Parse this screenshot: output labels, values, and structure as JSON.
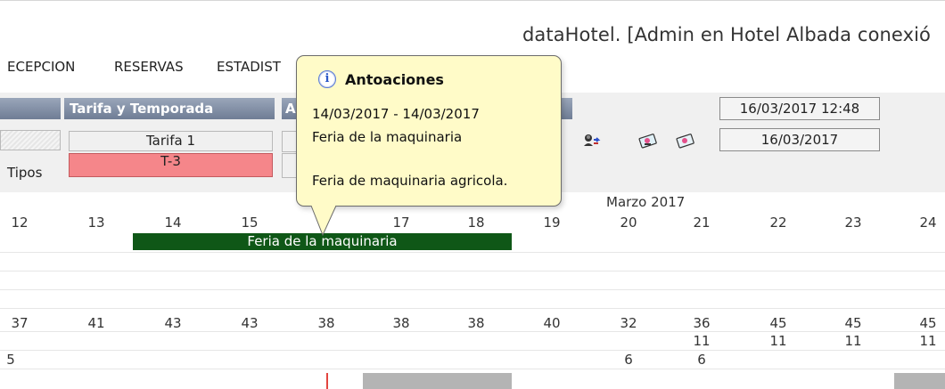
{
  "window": {
    "title": "dataHotel. [Admin en Hotel Albada conexió"
  },
  "menu": {
    "items": [
      {
        "label": "ECEPCION"
      },
      {
        "label": "RESERVAS"
      },
      {
        "label": "ESTADIST"
      }
    ]
  },
  "toolbar": {
    "tarifa_header": "Tarifa y Temporada",
    "second_header_fragment": "A",
    "tarifa_value": "Tarifa 1",
    "temporada_value": "T-3",
    "tipos_label": "Tipos",
    "datetime": "16/03/2017 12:48",
    "date": "16/03/2017",
    "colors": {
      "header_band": "#7b88a0",
      "temporada_bg": "#f5868a"
    }
  },
  "calendar": {
    "month": "Marzo 2017",
    "days": [
      "12",
      "13",
      "14",
      "15",
      "16",
      "17",
      "18",
      "19",
      "20",
      "21",
      "22",
      "23",
      "24"
    ],
    "event": {
      "label": "Feria de la maquinaria",
      "color": "#0f5717"
    },
    "row_totals": [
      "37",
      "41",
      "43",
      "43",
      "38",
      "38",
      "38",
      "40",
      "32",
      "36",
      "45",
      "45",
      "45"
    ],
    "row_second": [
      "",
      "",
      "",
      "",
      "",
      "",
      "",
      "",
      "",
      "11",
      "11",
      "11",
      "11"
    ],
    "row_third": [
      "5",
      "",
      "",
      "",
      "",
      "",
      "",
      "",
      "6",
      "6",
      "",
      "",
      ""
    ]
  },
  "tooltip": {
    "title": "Antoaciones",
    "date_range": "14/03/2017 - 14/03/2017",
    "name": "Feria de la maquinaria",
    "description": "Feria de maquinaria agricola."
  }
}
